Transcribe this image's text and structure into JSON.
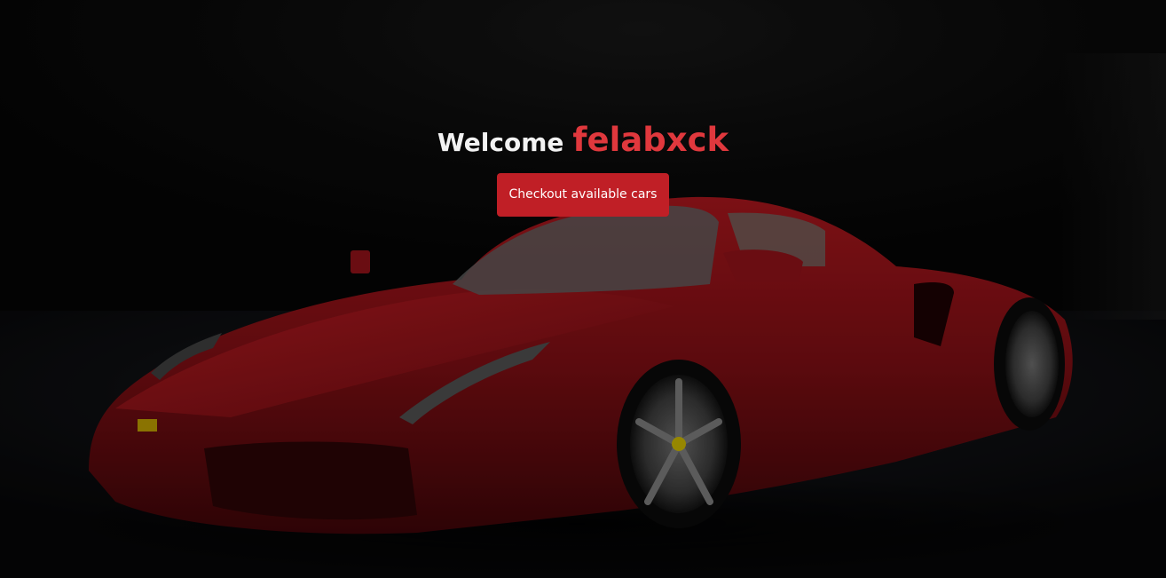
{
  "hero": {
    "welcome_text": "Welcome",
    "username": "felabxck",
    "cta_label": "Checkout available cars"
  },
  "colors": {
    "accent": "#e0383d",
    "button": "#c01f26",
    "background": "#050505",
    "car_body": "#7a0f14"
  },
  "background_image": {
    "subject": "red-sports-car"
  }
}
